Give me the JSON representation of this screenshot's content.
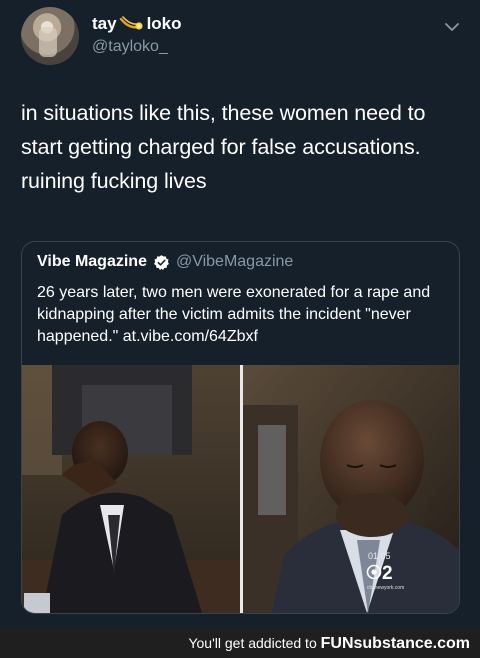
{
  "tweet": {
    "display_name_part1": "tay",
    "display_name_part2": "loko",
    "name_icon": "comet-icon",
    "handle": "@tayloko_",
    "text": "in situations like this, these women need to start getting charged for false accusations. ruining fucking lives",
    "menu_icon": "chevron-down-icon"
  },
  "quoted_tweet": {
    "display_name": "Vibe Magazine",
    "verified_icon": "verified-badge-icon",
    "handle": "@VibeMagazine",
    "text": "26 years later, two men were exonerated for a rape and kidnapping after the victim admits the incident \"never happened.\" at.vibe.com/64Zbxf",
    "media": {
      "left_panel": "man-covering-face-in-courtroom",
      "right_panel": "man-with-eyes-closed-in-courtroom",
      "overlay_time": "01  05",
      "overlay_logo": "cbs-2-logo",
      "overlay_logo_number": "2",
      "overlay_logo_caption": "cbsnewyork.com"
    }
  },
  "footer": {
    "text": "You'll get addicted to",
    "brand": "FUNsubstance.com"
  },
  "colors": {
    "background": "#15202b",
    "secondary_text": "#8899a6",
    "border": "#38444d",
    "accent": "#1da1f2"
  }
}
